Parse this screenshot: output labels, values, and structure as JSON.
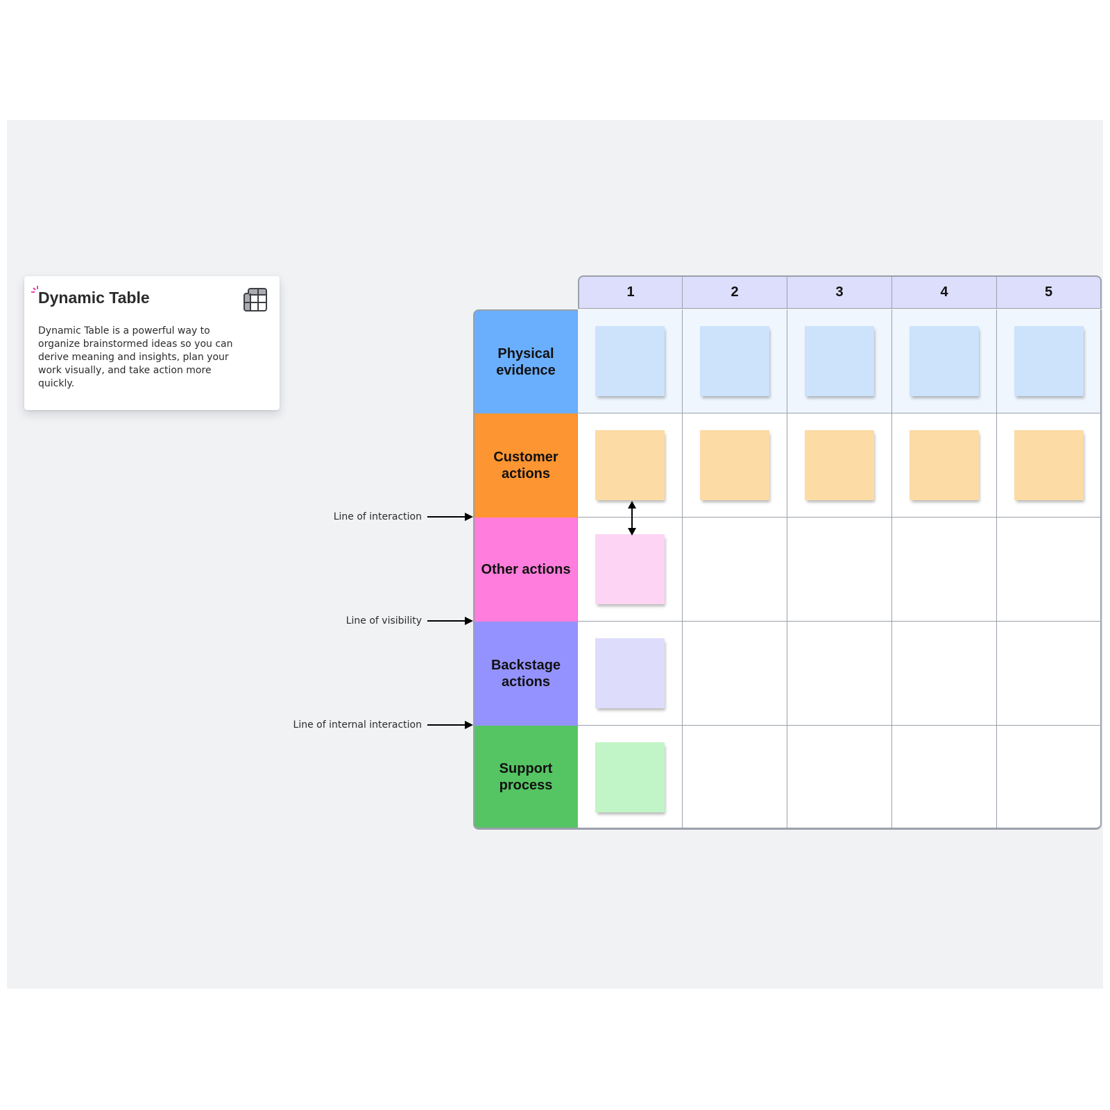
{
  "card": {
    "title": "Dynamic Table",
    "description": "Dynamic Table is a powerful way to organize brainstormed ideas so you can derive meaning and insights, plan your work visually, and take action more quickly.",
    "icon": "table-grid-icon",
    "accent_color": "#e0179b"
  },
  "table": {
    "columns": [
      "1",
      "2",
      "3",
      "4",
      "5"
    ],
    "header_color": "#dddefb",
    "rows": [
      {
        "label": "Physical evidence",
        "color": "#6aaffe",
        "sticky_color": "#cde2fb",
        "stickies": [
          true,
          true,
          true,
          true,
          true
        ]
      },
      {
        "label": "Customer actions",
        "color": "#fd9532",
        "sticky_color": "#fcdba5",
        "stickies": [
          true,
          true,
          true,
          true,
          true
        ]
      },
      {
        "label": "Other actions",
        "color": "#ff7ddc",
        "sticky_color": "#fdd4f4",
        "stickies": [
          true,
          false,
          false,
          false,
          false
        ]
      },
      {
        "label": "Backstage actions",
        "color": "#9492fe",
        "sticky_color": "#dddcfb",
        "stickies": [
          true,
          false,
          false,
          false,
          false
        ]
      },
      {
        "label": "Support process",
        "color": "#55c462",
        "sticky_color": "#c1f4c6",
        "stickies": [
          true,
          false,
          false,
          false,
          false
        ]
      }
    ]
  },
  "annotations": [
    {
      "label": "Line of interaction",
      "icon": "arrow-right-icon"
    },
    {
      "label": "Line of visibility",
      "icon": "arrow-right-icon"
    },
    {
      "label": "Line of internal interaction",
      "icon": "arrow-right-icon"
    }
  ],
  "connector": {
    "icon": "double-arrow-vertical-icon"
  }
}
